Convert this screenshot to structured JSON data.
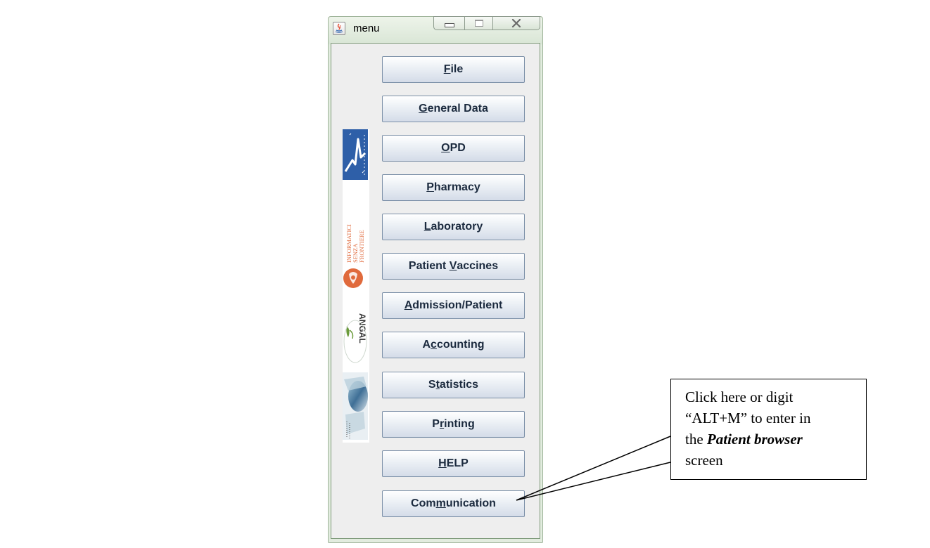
{
  "window": {
    "title": "menu"
  },
  "buttons": [
    {
      "name": "file-button",
      "pre": "",
      "mnemonic": "F",
      "post": "ile"
    },
    {
      "name": "general-data-button",
      "pre": "",
      "mnemonic": "G",
      "post": "eneral Data"
    },
    {
      "name": "opd-button",
      "pre": "",
      "mnemonic": "O",
      "post": "PD"
    },
    {
      "name": "pharmacy-button",
      "pre": "",
      "mnemonic": "P",
      "post": "harmacy"
    },
    {
      "name": "laboratory-button",
      "pre": "",
      "mnemonic": "L",
      "post": "aboratory"
    },
    {
      "name": "patient-vaccines-button",
      "pre": "Patient ",
      "mnemonic": "V",
      "post": "accines"
    },
    {
      "name": "admission-patient-button",
      "pre": "",
      "mnemonic": "A",
      "post": "dmission/Patient"
    },
    {
      "name": "accounting-button",
      "pre": "A",
      "mnemonic": "c",
      "post": "counting"
    },
    {
      "name": "statistics-button",
      "pre": "S",
      "mnemonic": "t",
      "post": "atistics"
    },
    {
      "name": "printing-button",
      "pre": "P",
      "mnemonic": "r",
      "post": "inting"
    },
    {
      "name": "help-button",
      "pre": "",
      "mnemonic": "H",
      "post": "ELP"
    },
    {
      "name": "communication-button",
      "pre": "Com",
      "mnemonic": "m",
      "post": "unication"
    }
  ],
  "logos": {
    "logo_b_text": "INFORMATICI SENZA FRONTIERE",
    "logo_c_text": "ANGAL"
  },
  "callout": {
    "line1": "Click here or digit",
    "line2": "“ALT+M” to enter in",
    "line3_pre": "the ",
    "line3_em": "Patient browser",
    "line4": "screen"
  },
  "colors": {
    "button_text": "#1b2a3e",
    "logo_blue": "#2e5fa8",
    "logo_orange": "#e06a3c"
  }
}
